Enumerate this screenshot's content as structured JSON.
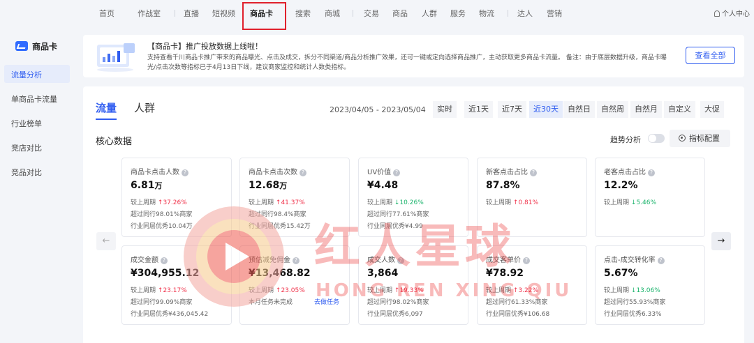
{
  "topnav": {
    "items": [
      "首页",
      "作战室",
      "直播",
      "短视频",
      "商品卡",
      "搜索",
      "商城",
      "交易",
      "商品",
      "人群",
      "服务",
      "物流",
      "达人",
      "营销"
    ],
    "active": "商品卡",
    "user": "个人中心"
  },
  "sidebar": {
    "brand": "商品卡",
    "items": [
      "流量分析",
      "单商品卡流量",
      "行业榜单",
      "竞店对比",
      "竞品对比"
    ]
  },
  "banner": {
    "title": "【商品卡】推广投放数据上线啦！",
    "text": "支持查看千川商品卡推广带来的商品曝光、点击及成交，拆分不同渠道/商品分析推广效果，还可一键或定向选择商品推广，主动获取更多商品卡流量。 备注：由于底层数据升级，商品卡曝光/点击次数等指标已于4月13日下线，建议商家监控和统计人数类指标。",
    "button": "查看全部"
  },
  "tabs": [
    "流量",
    "人群"
  ],
  "date_range": "2023/04/05 - 2023/05/04",
  "periods": [
    "实时",
    "近1天",
    "近7天",
    "近30天",
    "自然日",
    "自然周",
    "自然月",
    "自定义",
    "大促"
  ],
  "active_period": "近30天",
  "section_title": "核心数据",
  "trend_label": "趋势分析",
  "metric_config": "指标配置",
  "cards": [
    {
      "label": "商品卡点击人数",
      "value": "6.81",
      "unit": "万",
      "compare_label": "较上周期",
      "change": "37.26%",
      "dir": "up",
      "rank": "超过同行98.01%商家",
      "best": "行业同层优秀10.04万"
    },
    {
      "label": "商品卡点击次数",
      "value": "12.68",
      "unit": "万",
      "compare_label": "较上周期",
      "change": "41.37%",
      "dir": "up",
      "rank": "超过同行98.4%商家",
      "best": "行业同层优秀15.42万"
    },
    {
      "label": "UV价值",
      "value": "¥4.48",
      "unit": "",
      "compare_label": "较上周期",
      "change": "10.26%",
      "dir": "down",
      "rank": "超过同行77.61%商家",
      "best": "行业同层优秀¥4.99"
    },
    {
      "label": "新客点击占比",
      "value": "87.8%",
      "unit": "",
      "compare_label": "较上周期",
      "change": "0.81%",
      "dir": "up",
      "rank": "",
      "best": ""
    },
    {
      "label": "老客点击占比",
      "value": "12.2%",
      "unit": "",
      "compare_label": "较上周期",
      "change": "5.46%",
      "dir": "down",
      "rank": "",
      "best": ""
    },
    {
      "label": "成交金额",
      "value": "¥304,955.12",
      "unit": "",
      "compare_label": "较上周期",
      "change": "23.17%",
      "dir": "up",
      "rank": "超过同行99.09%商家",
      "best": "行业同层优秀¥436,045.42"
    },
    {
      "label": "预估减免佣金",
      "value": "¥13,468.82",
      "unit": "",
      "compare_label": "较上周期",
      "change": "23.05%",
      "dir": "up",
      "rank": "本月任务未完成",
      "best": "",
      "link": "去做任务"
    },
    {
      "label": "成交人数",
      "value": "3,864",
      "unit": "",
      "compare_label": "较上周期",
      "change": "19.33%",
      "dir": "up",
      "rank": "超过同行98.02%商家",
      "best": "行业同层优秀6,097"
    },
    {
      "label": "成交客单价",
      "value": "¥78.92",
      "unit": "",
      "compare_label": "较上周期",
      "change": "3.22%",
      "dir": "up",
      "rank": "超过同行61.33%商家",
      "best": "行业同层优秀¥106.68"
    },
    {
      "label": "点击-成交转化率",
      "value": "5.67%",
      "unit": "",
      "compare_label": "较上周期",
      "change": "13.06%",
      "dir": "down",
      "rank": "超过同行55.93%商家",
      "best": "行业同层优秀6.33%"
    }
  ],
  "watermark": {
    "cn": "红人星球",
    "en": "HONG REN XING QIU"
  },
  "colors": {
    "accent": "#2f5cf0",
    "up": "#f0334b",
    "down": "#19b36b",
    "highlight_box": "#e0202c"
  }
}
